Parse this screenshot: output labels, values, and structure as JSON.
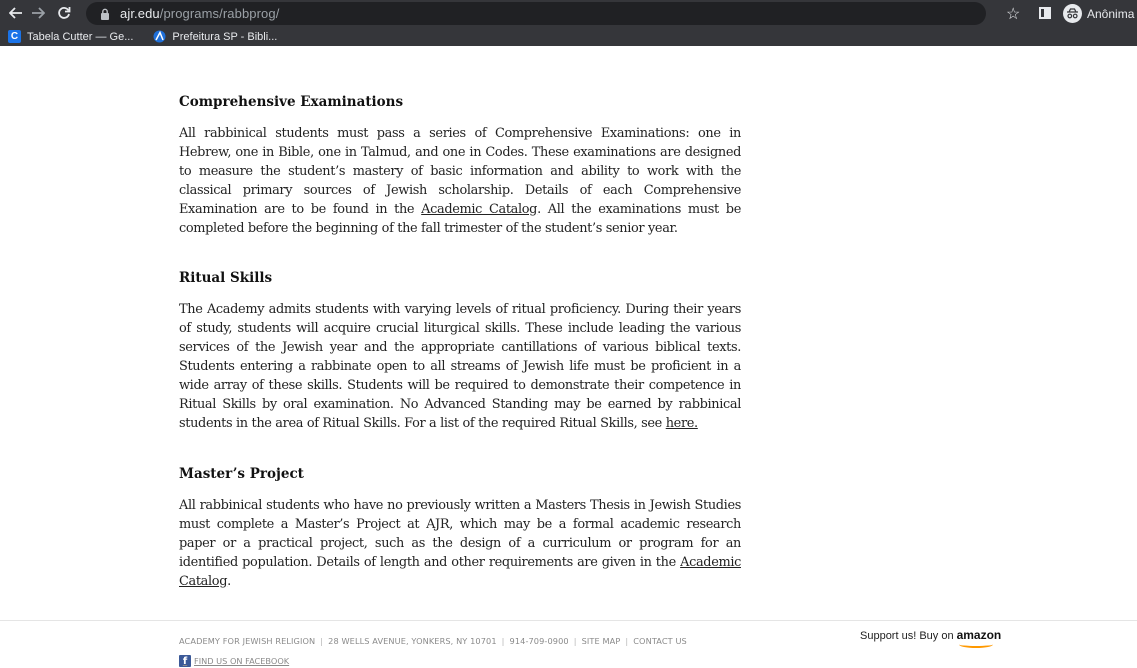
{
  "browser": {
    "url_host": "ajr.edu",
    "url_path": "/programs/rabbprog/",
    "profile_label": "Anônima",
    "bookmarks": [
      {
        "label": "Tabela Cutter — Ge...",
        "icon": "cutter-c-icon"
      },
      {
        "label": "Prefeitura SP - Bibli...",
        "icon": "prefeitura-sp-icon"
      }
    ]
  },
  "sections": [
    {
      "heading": "Comprehensive Examinations",
      "paragraph_parts": [
        "All rabbinical students must pass a series of Comprehensive Examinations: one in Hebrew, one in Bible, one in Talmud, and one in Codes. These examinations are designed to measure the student’s mastery of basic information and ability to work with the classical primary sources of Jewish scholarship. Details of each Comprehensive Examination are to be found in the ",
        "Academic Catalog",
        ". All the examinations must be completed before the beginning of the fall trimester of the student’s senior year."
      ]
    },
    {
      "heading": "Ritual Skills",
      "paragraph_parts": [
        "The Academy admits students with varying levels of ritual proficiency. During their years of study, students will acquire crucial liturgical skills. These include leading the various services of the Jewish year and the appropriate cantillations of various biblical texts. Students entering a rabbinate open to all streams of Jewish life must be proficient in a wide array of these skills. Students will be required to demonstrate their competence in Ritual Skills by oral examination. No Advanced Standing may be earned by rabbinical students in the area of Ritual Skills. For a list of the required Ritual Skills, see ",
        "here.",
        ""
      ]
    },
    {
      "heading": "Master’s Project",
      "paragraph_parts": [
        "All rabbinical students who have no previously written a Masters Thesis in Jewish Studies must complete a Master’s Project at AJR, which may be a formal academic research paper or a practical project, such as the design of a curriculum or program for an identified population. Details of length and other requirements are given in the ",
        "Academic Catalog",
        "."
      ]
    }
  ],
  "footer": {
    "org": "ACADEMY FOR JEWISH RELIGION",
    "address": "28 WELLS AVENUE, YONKERS, NY 10701",
    "phone": "914-709-0900",
    "site_map": "SITE MAP",
    "contact": "CONTACT US",
    "separator": "|",
    "facebook": "FIND US ON FACEBOOK",
    "support_text": "Support us! Buy on",
    "amazon_text": "amazon"
  },
  "colors": {
    "chrome_bg": "#35363a",
    "omnibox_bg": "#202124",
    "facebook_blue": "#3b5998",
    "amazon_orange": "#ff9900"
  }
}
